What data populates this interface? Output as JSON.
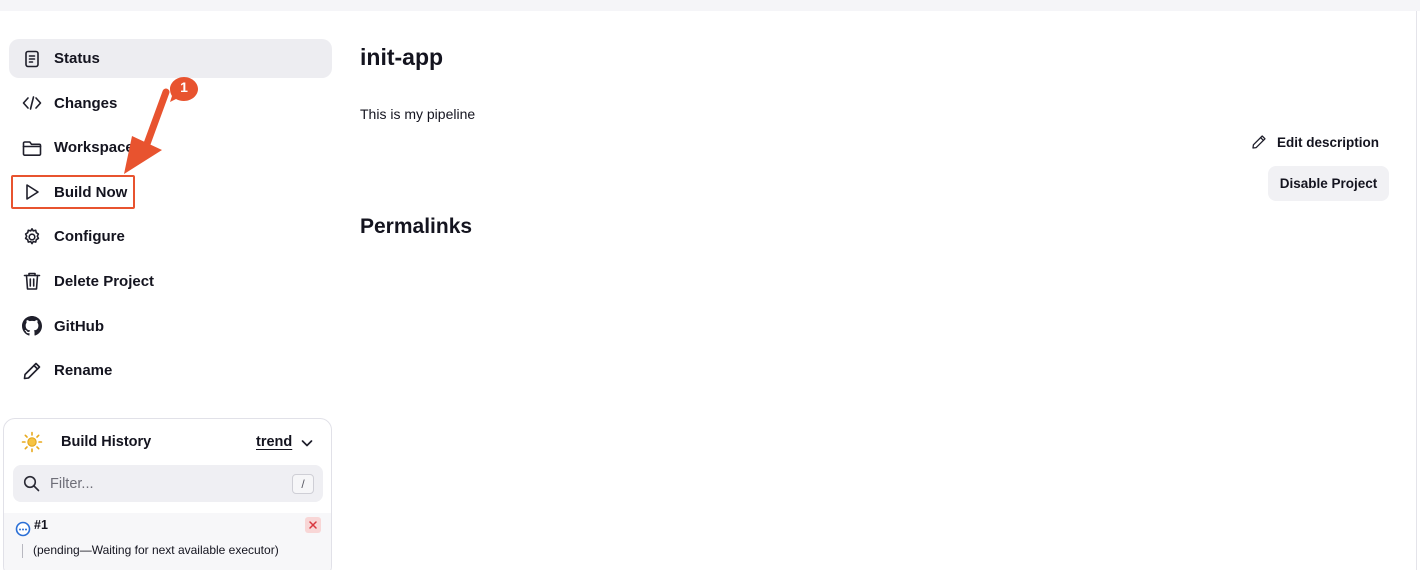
{
  "sidebar": {
    "items": [
      {
        "label": "Status",
        "icon": "status-document-icon",
        "active": true
      },
      {
        "label": "Changes",
        "icon": "code-brackets-icon",
        "active": false
      },
      {
        "label": "Workspace",
        "icon": "folder-icon",
        "active": false
      },
      {
        "label": "Build Now",
        "icon": "play-icon",
        "active": false,
        "highlighted": true
      },
      {
        "label": "Configure",
        "icon": "gear-icon",
        "active": false
      },
      {
        "label": "Delete Project",
        "icon": "trash-icon",
        "active": false
      },
      {
        "label": "GitHub",
        "icon": "github-icon",
        "active": false
      },
      {
        "label": "Rename",
        "icon": "pencil-icon",
        "active": false
      }
    ]
  },
  "annotation": {
    "badge_number": "1",
    "color": "#e8532f"
  },
  "build_history": {
    "title": "Build History",
    "trend_label": "trend",
    "filter_placeholder": "Filter...",
    "shortcut_key": "/",
    "builds": [
      {
        "number": "#1",
        "status_text": "(pending—Waiting for next available executor)",
        "status_icon": "pending-icon"
      }
    ]
  },
  "main": {
    "title": "init-app",
    "description": "This is my pipeline",
    "edit_description_label": "Edit description",
    "disable_button_label": "Disable Project",
    "permalinks_heading": "Permalinks"
  }
}
